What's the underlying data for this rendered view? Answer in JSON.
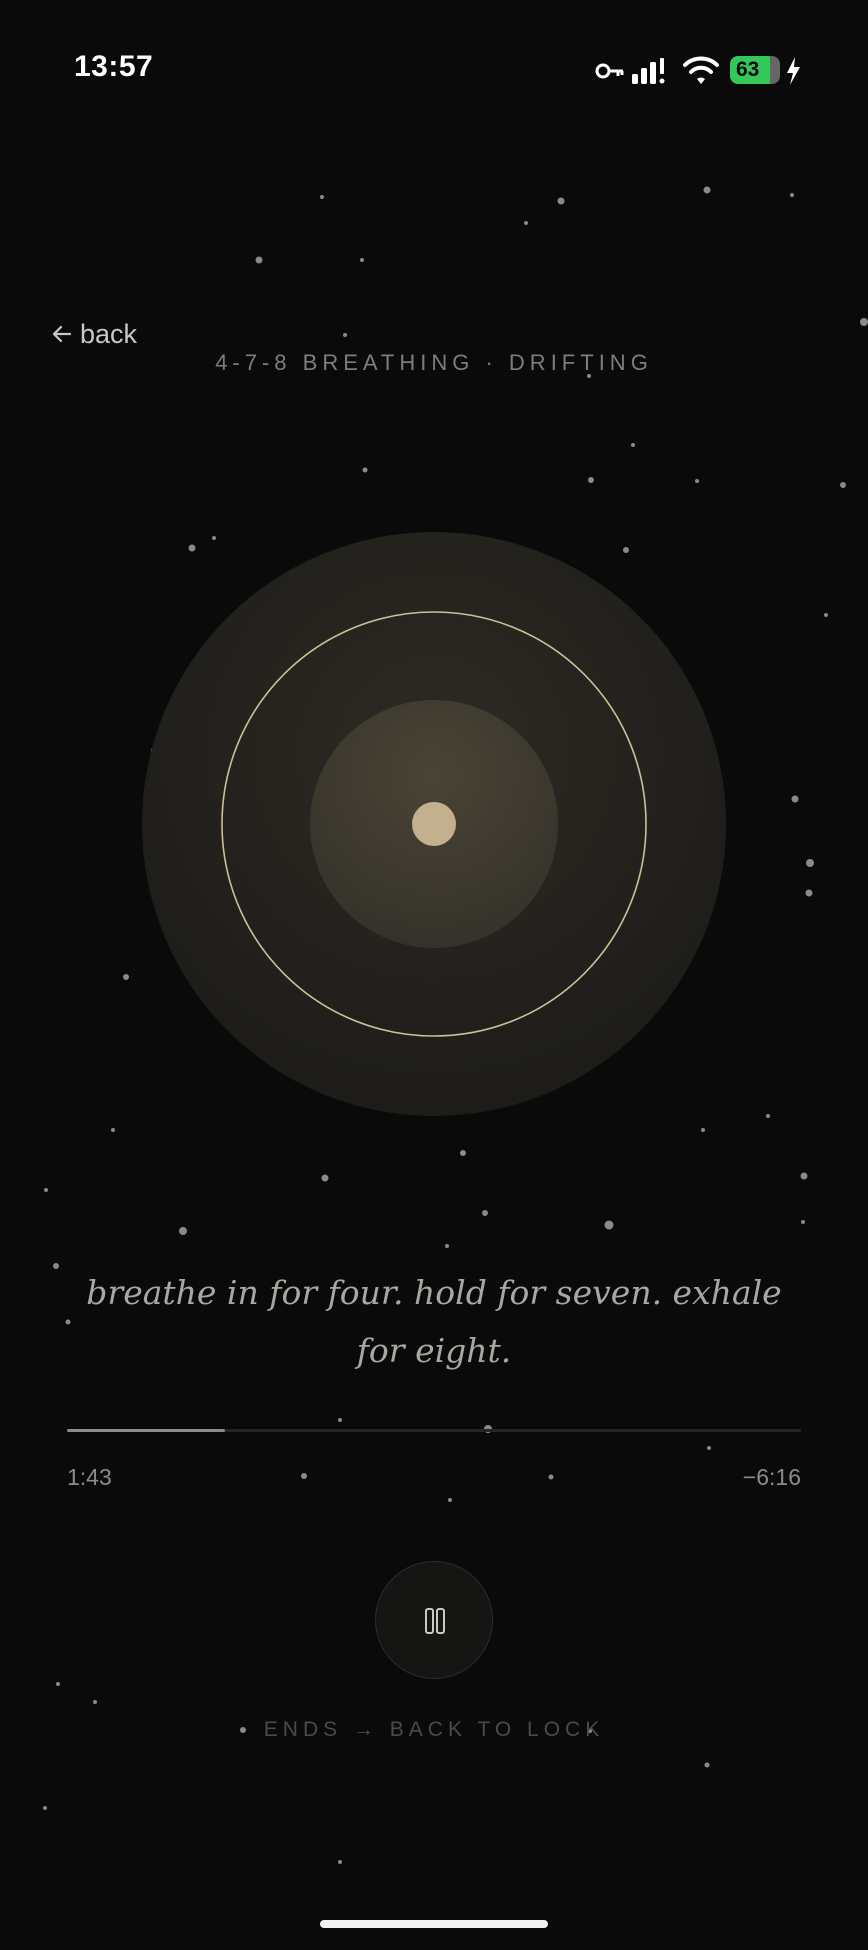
{
  "status_bar": {
    "time": "13:57",
    "battery": "63",
    "icons": [
      "vpn-key-icon",
      "cellular-signal-icon",
      "wifi-icon",
      "battery-icon",
      "charging-bolt-icon"
    ]
  },
  "nav": {
    "back_label": "back",
    "back_icon": "arrow-left-icon"
  },
  "session": {
    "title": "4-7-8 BREATHING · DRIFTING",
    "instruction": "breathe in for four. hold for seven. exhale for eight."
  },
  "playback": {
    "elapsed": "1:43",
    "remaining": "−6:16",
    "progress": 0.215,
    "control_icon": "pause-icon"
  },
  "footer": {
    "note": "ENDS → BACK TO LOCK"
  },
  "colors": {
    "background": "#0a0a0a",
    "accent": "#c9b98f",
    "battery": "#34c759"
  }
}
